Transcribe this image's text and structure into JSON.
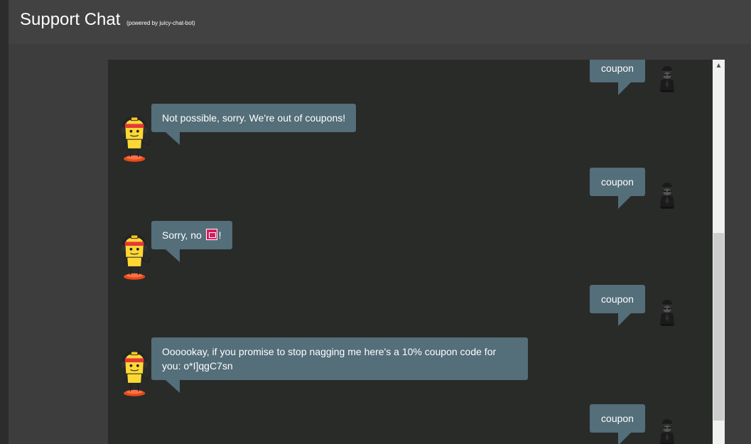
{
  "header": {
    "title": "Support Chat",
    "subtitle": "(powered by juicy-chat-bot)"
  },
  "chat": {
    "messages": [
      {
        "from": "user",
        "text": "coupon",
        "avatar": "spy-icon"
      },
      {
        "from": "bot",
        "text": "Not possible, sorry. We're out of coupons!",
        "avatar": "juicy-bot-icon"
      },
      {
        "from": "user",
        "text": "coupon",
        "avatar": "spy-icon"
      },
      {
        "from": "bot",
        "text": "Sorry, no",
        "text_suffix": "!",
        "emoji": "emoji-box-icon",
        "avatar": "juicy-bot-icon"
      },
      {
        "from": "user",
        "text": "coupon",
        "avatar": "spy-icon"
      },
      {
        "from": "bot",
        "text": "Oooookay, if you promise to stop nagging me here's a 10% coupon code for you: o*I]qgC7sn",
        "avatar": "juicy-bot-icon"
      },
      {
        "from": "user",
        "text": "coupon",
        "avatar": "spy-icon"
      }
    ]
  },
  "scrollbar": {
    "up_arrow": "chevron-up-icon"
  },
  "colors": {
    "page_background": "#3d3d3d",
    "header_background": "#424242",
    "chat_background": "#292b29",
    "bubble": "#546e7a",
    "bubble_text": "#ffffff",
    "emoji": "#d81b60"
  }
}
